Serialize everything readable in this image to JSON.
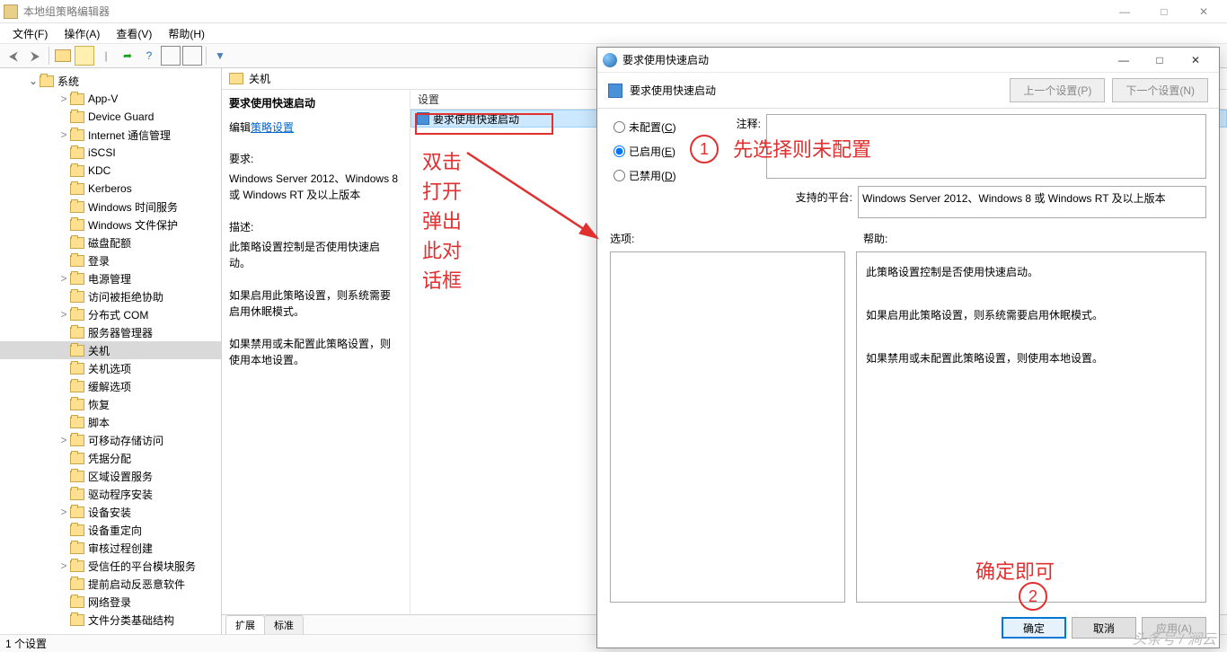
{
  "window": {
    "title": "本地组策略编辑器",
    "min": "—",
    "max": "□",
    "close": "✕"
  },
  "menubar": {
    "file": "文件(F)",
    "action": "操作(A)",
    "view": "查看(V)",
    "help": "帮助(H)"
  },
  "tree": {
    "root": "系统",
    "items": [
      "App-V",
      "Device Guard",
      "Internet 通信管理",
      "iSCSI",
      "KDC",
      "Kerberos",
      "Windows 时间服务",
      "Windows 文件保护",
      "磁盘配额",
      "登录",
      "电源管理",
      "访问被拒绝协助",
      "分布式 COM",
      "服务器管理器",
      "关机",
      "关机选项",
      "缓解选项",
      "恢复",
      "脚本",
      "可移动存储访问",
      "凭据分配",
      "区域设置服务",
      "驱动程序安装",
      "设备安装",
      "设备重定向",
      "审核过程创建",
      "受信任的平台模块服务",
      "提前启动反恶意软件",
      "网络登录",
      "文件分类基础结构"
    ],
    "selected": "关机"
  },
  "content": {
    "header": "关机",
    "title": "要求使用快速启动",
    "edit_label": "编辑",
    "edit_link": "策略设置",
    "req_label": "要求:",
    "req_text": "Windows Server 2012、Windows 8 或 Windows RT 及以上版本",
    "desc_label": "描述:",
    "desc_text": "此策略设置控制是否使用快速启动。",
    "p1": "如果启用此策略设置，则系统需要启用休眠模式。",
    "p2": "如果禁用或未配置此策略设置，则使用本地设置。",
    "list_header": "设置",
    "list_item": "要求使用快速启动"
  },
  "tabs": {
    "ext": "扩展",
    "std": "标准"
  },
  "status": "1 个设置",
  "dialog": {
    "title": "要求使用快速启动",
    "header": "要求使用快速启动",
    "prev": "上一个设置(P)",
    "next": "下一个设置(N)",
    "radio_unconfigured": "未配置(C)",
    "radio_enabled": "已启用(E)",
    "radio_disabled": "已禁用(D)",
    "comment_label": "注释:",
    "platform_label": "支持的平台:",
    "platform_text": "Windows Server 2012、Windows 8 或 Windows RT 及以上版本",
    "options_label": "选项:",
    "help_label": "帮助:",
    "help_p1": "此策略设置控制是否使用快速启动。",
    "help_p2": "如果启用此策略设置，则系统需要启用休眠模式。",
    "help_p3": "如果禁用或未配置此策略设置，则使用本地设置。",
    "ok": "确定",
    "cancel": "取消",
    "apply": "应用(A)"
  },
  "annotations": {
    "dblclick": "双击\n打开\n弹出\n此对\n话框",
    "step1_text": "先选择则未配置",
    "step2_text": "确定即可",
    "n1": "1",
    "n2": "2"
  },
  "watermark": "头条号 / 涧云"
}
